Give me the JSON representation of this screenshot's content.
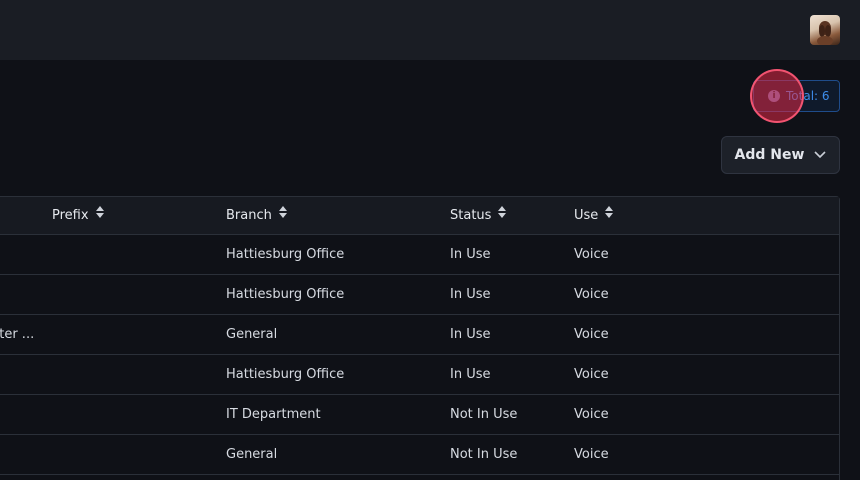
{
  "header": {
    "avatar": "user-avatar"
  },
  "summary": {
    "total_label": "Total: 6"
  },
  "toolbar": {
    "add_new_label": "Add New"
  },
  "table": {
    "columns": [
      "Prefix",
      "Branch",
      "Status",
      "Use"
    ],
    "rows": [
      {
        "name": "",
        "branch": "Hattiesburg Office",
        "status": "In Use",
        "use": "Voice"
      },
      {
        "name": "",
        "branch": "Hattiesburg Office",
        "status": "In Use",
        "use": "Voice"
      },
      {
        "name": "nter ...",
        "branch": "General",
        "status": "In Use",
        "use": "Voice"
      },
      {
        "name": "",
        "branch": "Hattiesburg Office",
        "status": "In Use",
        "use": "Voice"
      },
      {
        "name": "",
        "branch": "IT Department",
        "status": "Not In Use",
        "use": "Voice"
      },
      {
        "name": "",
        "branch": "General",
        "status": "Not In Use",
        "use": "Voice"
      }
    ]
  }
}
